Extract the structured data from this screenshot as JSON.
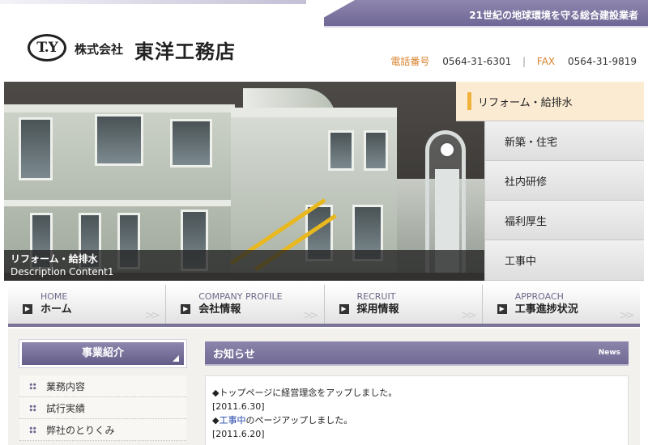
{
  "header": {
    "tagline": "21世紀の地球環境を守る総合建設業者",
    "logo_mark": "T.Y",
    "company_prefix": "株式会社",
    "company_name": "東洋工務店",
    "tel_label": "電話番号",
    "tel": "0564-31-6301",
    "separator": "|",
    "fax_label": "FAX",
    "fax": "0564-31-9819"
  },
  "hero": {
    "caption_title": "リフォーム・給排水",
    "caption_desc": "Description Content1",
    "menu": [
      {
        "label": "リフォーム・給排水",
        "active": true
      },
      {
        "label": "新築・住宅"
      },
      {
        "label": "社内研修"
      },
      {
        "label": "福利厚生"
      },
      {
        "label": "工事中"
      }
    ]
  },
  "gnav": [
    {
      "en": "HOME",
      "jp": "ホーム"
    },
    {
      "en": "COMPANY PROFILE",
      "jp": "会社情報"
    },
    {
      "en": "RECRUIT",
      "jp": "採用情報"
    },
    {
      "en": "APPROACH",
      "jp": "工事進捗状況"
    }
  ],
  "sidebar": {
    "title": "事業紹介",
    "items": [
      "業務内容",
      "試行実績",
      "弊社のとりくみ"
    ]
  },
  "news": {
    "title": "お知らせ",
    "title_en": "News",
    "entries": [
      {
        "bullet": "◆",
        "text": "トップページに経営理念をアップしました。",
        "date": "[2011.6.30]"
      },
      {
        "bullet": "◆",
        "link": "工事中",
        "text": "のページアップしました。",
        "date": "[2011.6.20]"
      }
    ]
  },
  "colors": {
    "accent": "#7a7297",
    "highlight": "#f0b23c",
    "contact_label": "#d9822b"
  }
}
